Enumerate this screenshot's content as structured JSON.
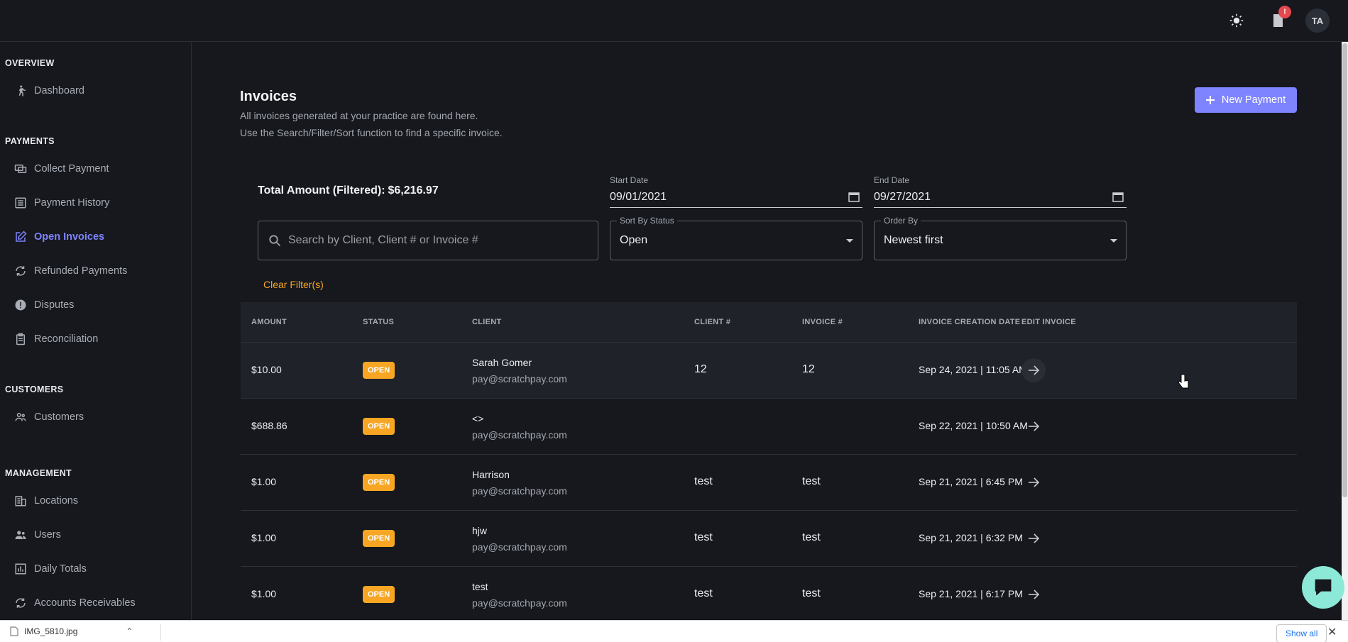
{
  "topbar": {
    "notification_badge": "!",
    "avatar_initials": "TA"
  },
  "sidebar": {
    "sections": [
      {
        "label": "OVERVIEW",
        "items": [
          {
            "label": "Dashboard",
            "icon": "walk-icon"
          }
        ]
      },
      {
        "label": "PAYMENTS",
        "items": [
          {
            "label": "Collect Payment",
            "icon": "collect-icon"
          },
          {
            "label": "Payment History",
            "icon": "history-icon"
          },
          {
            "label": "Open Invoices",
            "icon": "edit-icon",
            "active": true
          },
          {
            "label": "Refunded Payments",
            "icon": "refund-icon"
          },
          {
            "label": "Disputes",
            "icon": "alert-icon"
          },
          {
            "label": "Reconciliation",
            "icon": "clipboard-icon"
          }
        ]
      },
      {
        "label": "CUSTOMERS",
        "items": [
          {
            "label": "Customers",
            "icon": "people-icon"
          }
        ]
      },
      {
        "label": "MANAGEMENT",
        "items": [
          {
            "label": "Locations",
            "icon": "building-icon"
          },
          {
            "label": "Users",
            "icon": "users-icon"
          },
          {
            "label": "Daily Totals",
            "icon": "chart-icon"
          },
          {
            "label": "Accounts Receivables",
            "icon": "sync-icon"
          }
        ]
      }
    ]
  },
  "page": {
    "title": "Invoices",
    "subtitle1": "All invoices generated at your practice are found here.",
    "subtitle2": "Use the Search/Filter/Sort function to find a specific invoice.",
    "new_button": "New Payment"
  },
  "filters": {
    "total_label": "Total Amount (Filtered):",
    "total_value": "$6,216.97",
    "start_date_label": "Start Date",
    "start_date": "09/01/2021",
    "end_date_label": "End Date",
    "end_date": "09/27/2021",
    "search_placeholder": "Search by Client, Client # or Invoice #",
    "status_label": "Sort By Status",
    "status_value": "Open",
    "order_label": "Order By",
    "order_value": "Newest first",
    "clear": "Clear Filter(s)"
  },
  "table": {
    "headers": [
      "AMOUNT",
      "STATUS",
      "CLIENT",
      "CLIENT #",
      "INVOICE #",
      "INVOICE CREATION DATE",
      "EDIT INVOICE"
    ],
    "rows": [
      {
        "amount": "$10.00",
        "status": "OPEN",
        "client": "Sarah Gomer",
        "email": "pay@scratchpay.com",
        "client_no": "12",
        "invoice_no": "12",
        "date": "Sep 24, 2021 | 11:05 AM"
      },
      {
        "amount": "$688.86",
        "status": "OPEN",
        "client": "<>",
        "email": "pay@scratchpay.com",
        "client_no": "",
        "invoice_no": "",
        "date": "Sep 22, 2021 | 10:50 AM"
      },
      {
        "amount": "$1.00",
        "status": "OPEN",
        "client": "Harrison",
        "email": "pay@scratchpay.com",
        "client_no": "test",
        "invoice_no": "test",
        "date": "Sep 21, 2021 | 6:45 PM"
      },
      {
        "amount": "$1.00",
        "status": "OPEN",
        "client": "hjw",
        "email": "pay@scratchpay.com",
        "client_no": "test",
        "invoice_no": "test",
        "date": "Sep 21, 2021 | 6:32 PM"
      },
      {
        "amount": "$1.00",
        "status": "OPEN",
        "client": "test",
        "email": "pay@scratchpay.com",
        "client_no": "test",
        "invoice_no": "test",
        "date": "Sep 21, 2021 | 6:17 PM"
      }
    ]
  },
  "download_bar": {
    "file": "IMG_5810.jpg",
    "show_all": "Show all"
  },
  "colors": {
    "accent": "#7e84ff",
    "open_badge": "#f6a623",
    "chat": "#8ce9d7"
  }
}
